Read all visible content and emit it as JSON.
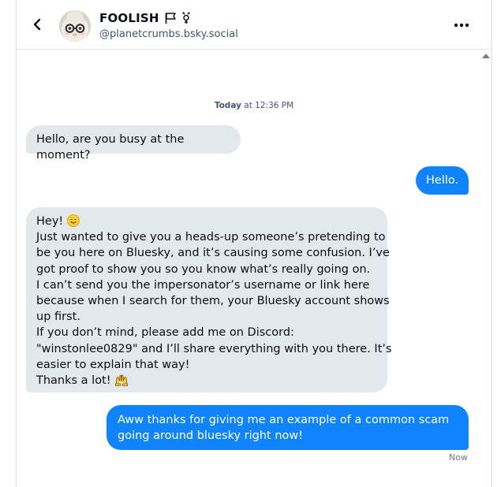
{
  "header": {
    "display_name": "FOOLISH",
    "flag_icons": "🏳️⚧",
    "handle": "@planetcrumbs.bsky.social"
  },
  "conversation": {
    "timestamp_day": "Today",
    "timestamp_rest": " at 12:36 PM",
    "messages": [
      {
        "from": "them",
        "text": "Hello, are you busy at the moment?"
      },
      {
        "from": "me",
        "text": "Hello."
      },
      {
        "from": "them",
        "lines": [
          "Hey! ",
          "Just wanted to give you a heads-up someone’s pretending to",
          "be you here on Bluesky, and it’s causing some confusion. I’ve",
          "got proof to show you so you know what’s really going on.",
          "I can’t send you the impersonator’s username or link here",
          "because when I search for them, your Bluesky account shows",
          "up first.",
          "If you don’t mind, please add me on Discord:",
          "\"winstonlee0829\" and I’ll share everything with you there. It’s",
          "easier to explain that way!",
          "Thanks a lot! "
        ]
      },
      {
        "from": "me",
        "lines": [
          "Aww thanks for giving me an example of a common scam",
          "going around bluesky right now!"
        ]
      }
    ],
    "last_status": "Now"
  },
  "icons": {
    "back": "chevron-left-icon",
    "more": "more-horizontal-icon",
    "smile": "smiling-face-emoji",
    "hands": "raising-hands-emoji"
  },
  "colors": {
    "outgoing_bubble": "#1083fe",
    "incoming_bubble": "#e3e8ed"
  }
}
